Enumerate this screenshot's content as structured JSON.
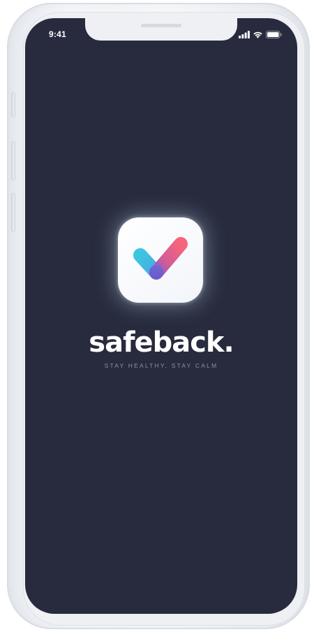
{
  "status_bar": {
    "time": "9:41",
    "icons": [
      "signal-icon",
      "wifi-icon",
      "battery-icon"
    ]
  },
  "splash": {
    "app_icon": "safeback-check-logo-icon",
    "brand_name": "safeback.",
    "tagline": "STAY HEALTHY, STAY CALM"
  },
  "colors": {
    "screen_background": "#272b3d",
    "brand_text": "#ffffff",
    "tagline_text": "#8a90a6",
    "logo_cyan": "#3cc6e0",
    "logo_purple": "#7a5fd0",
    "logo_pink": "#f0607a"
  }
}
